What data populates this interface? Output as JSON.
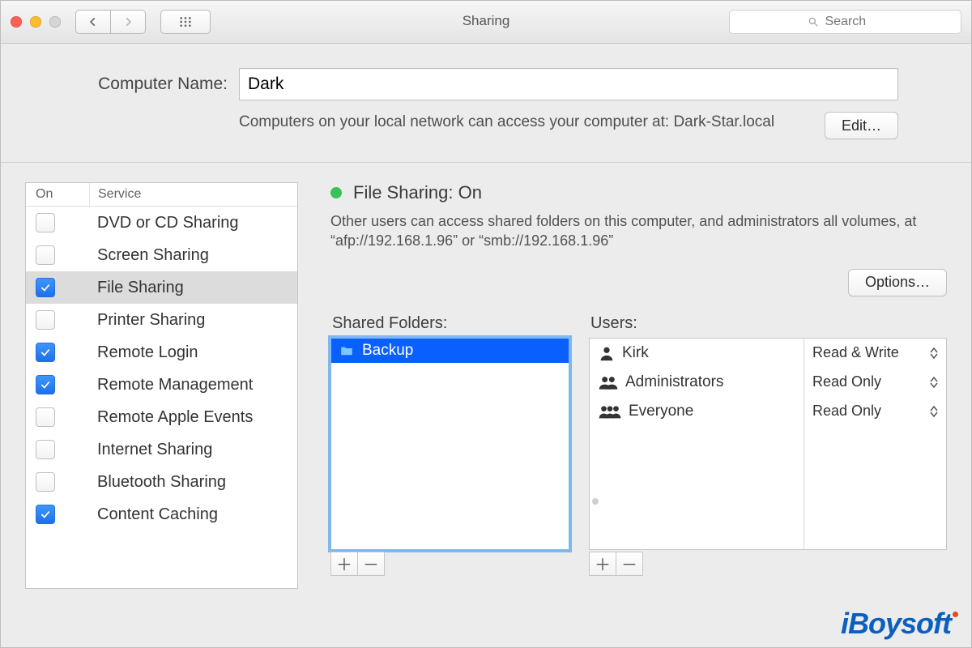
{
  "window": {
    "title": "Sharing"
  },
  "search": {
    "placeholder": "Search"
  },
  "computer_name": {
    "label": "Computer Name:",
    "value": "Dark",
    "subtext": "Computers on your local network can access your computer at: Dark-Star.local",
    "edit_label": "Edit…"
  },
  "services_header": {
    "on": "On",
    "service": "Service"
  },
  "services": [
    {
      "label": "DVD or CD Sharing",
      "checked": false,
      "selected": false
    },
    {
      "label": "Screen Sharing",
      "checked": false,
      "selected": false
    },
    {
      "label": "File Sharing",
      "checked": true,
      "selected": true
    },
    {
      "label": "Printer Sharing",
      "checked": false,
      "selected": false
    },
    {
      "label": "Remote Login",
      "checked": true,
      "selected": false
    },
    {
      "label": "Remote Management",
      "checked": true,
      "selected": false
    },
    {
      "label": "Remote Apple Events",
      "checked": false,
      "selected": false
    },
    {
      "label": "Internet Sharing",
      "checked": false,
      "selected": false
    },
    {
      "label": "Bluetooth Sharing",
      "checked": false,
      "selected": false
    },
    {
      "label": "Content Caching",
      "checked": true,
      "selected": false
    }
  ],
  "status": {
    "title": "File Sharing: On",
    "desc": "Other users can access shared folders on this computer, and administrators all volumes, at “afp://192.168.1.96” or “smb://192.168.1.96”",
    "options_label": "Options…"
  },
  "shared_folders": {
    "heading": "Shared Folders:",
    "items": [
      {
        "name": "Backup",
        "selected": true
      }
    ]
  },
  "users": {
    "heading": "Users:",
    "rows": [
      {
        "name": "Kirk",
        "perm": "Read & Write",
        "icon": "single"
      },
      {
        "name": "Administrators",
        "perm": "Read Only",
        "icon": "pair"
      },
      {
        "name": "Everyone",
        "perm": "Read Only",
        "icon": "group"
      }
    ]
  },
  "watermark": "iBoysoft"
}
